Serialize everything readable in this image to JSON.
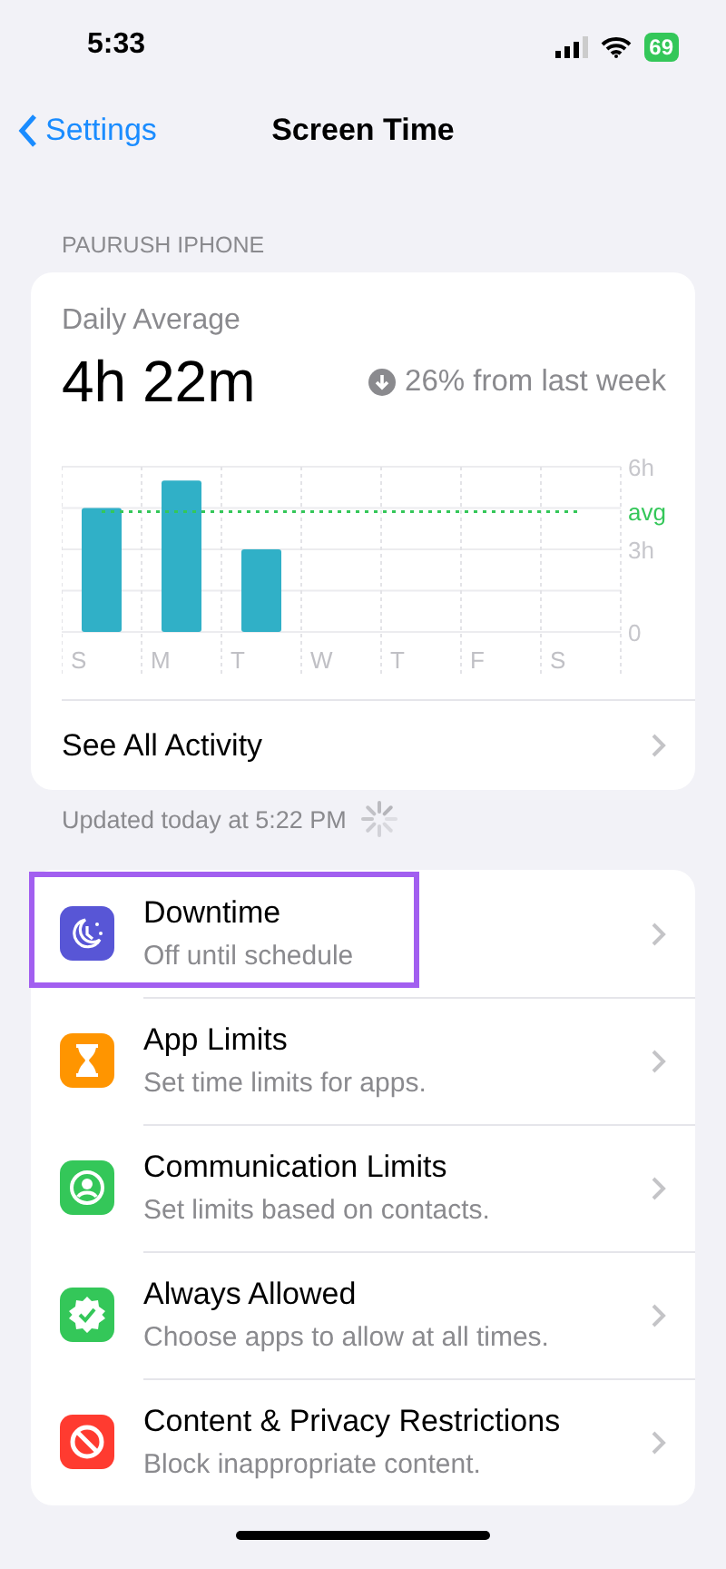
{
  "status_bar": {
    "time": "5:33",
    "battery": "69"
  },
  "nav": {
    "back": "Settings",
    "title": "Screen Time"
  },
  "section_header": "PAURUSH IPHONE",
  "summary": {
    "label": "Daily Average",
    "value": "4h 22m",
    "change": "26% from last week",
    "chart_data": {
      "type": "bar",
      "categories": [
        "S",
        "M",
        "T",
        "W",
        "T",
        "F",
        "S"
      ],
      "series": [
        {
          "color": "#30b0c7",
          "values": [
            4.5,
            5.5,
            3.0,
            null,
            null,
            null,
            null
          ]
        },
        {
          "name": "avg",
          "type": "line",
          "line_style": "dashed",
          "color": "#34c759",
          "values": [
            4.37,
            4.37,
            4.37,
            4.37,
            4.37,
            4.37,
            4.37
          ]
        }
      ],
      "ylim": [
        0,
        6
      ],
      "yticks": [
        {
          "value": 0,
          "label": "0"
        },
        {
          "value": 3,
          "label": "3h"
        },
        {
          "value": 6,
          "label": "6h"
        }
      ]
    },
    "link": "See All Activity"
  },
  "updated": "Updated today at 5:22 PM",
  "items": [
    {
      "kind": "downtime",
      "title": "Downtime",
      "subtitle": "Off until schedule",
      "color": "#5856d6",
      "highlighted": true
    },
    {
      "kind": "app-limits",
      "title": "App Limits",
      "subtitle": "Set time limits for apps.",
      "color": "#ff9500",
      "highlighted": false
    },
    {
      "kind": "communication",
      "title": "Communication Limits",
      "subtitle": "Set limits based on contacts.",
      "color": "#34c759",
      "highlighted": false
    },
    {
      "kind": "always-allowed",
      "title": "Always Allowed",
      "subtitle": "Choose apps to allow at all times.",
      "color": "#34c759",
      "highlighted": false
    },
    {
      "kind": "restrictions",
      "title": "Content & Privacy Restrictions",
      "subtitle": "Block inappropriate content.",
      "color": "#ff3b30",
      "highlighted": false
    }
  ]
}
